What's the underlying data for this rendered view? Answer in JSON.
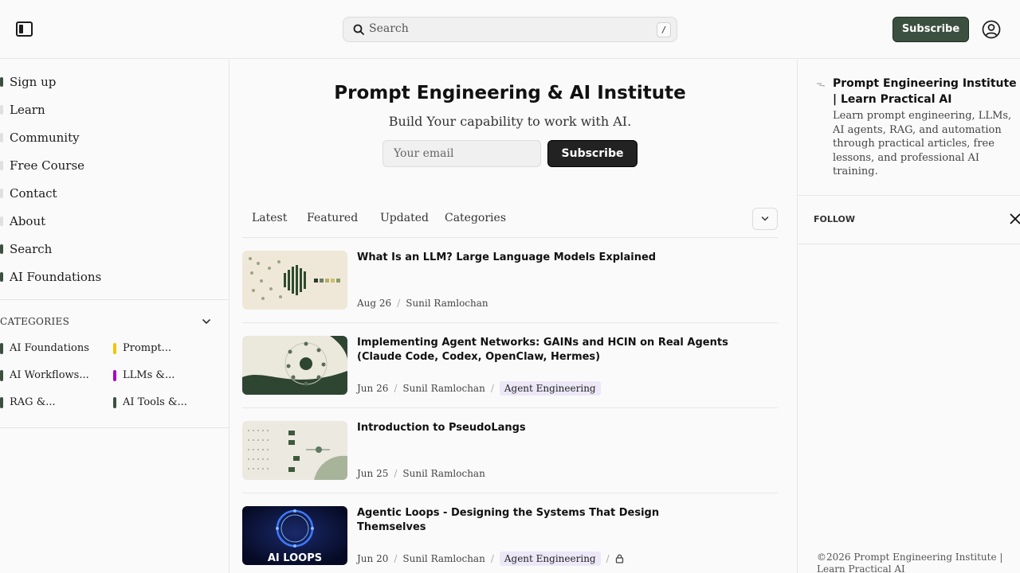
{
  "header": {
    "search_placeholder": "Search",
    "search_shortcut": "/",
    "subscribe_label": "Subscribe"
  },
  "sidebar": {
    "nav": [
      {
        "label": "Sign up",
        "dot": "dark"
      },
      {
        "label": "Learn",
        "dot": "light"
      },
      {
        "label": "Community",
        "dot": "light"
      },
      {
        "label": "Free Course",
        "dot": "light"
      },
      {
        "label": "Contact",
        "dot": "light"
      },
      {
        "label": "About",
        "dot": "light"
      },
      {
        "label": "Search",
        "dot": "dark"
      },
      {
        "label": "AI Foundations",
        "dot": "dark"
      }
    ],
    "categories_header": "CATEGORIES",
    "categories": [
      {
        "label": "AI Foundations",
        "color": "#3c5040"
      },
      {
        "label": "Prompt...",
        "color": "#f2c500"
      },
      {
        "label": "AI Workflows...",
        "color": "#3c5040"
      },
      {
        "label": "LLMs &...",
        "color": "#a800c8"
      },
      {
        "label": "RAG &...",
        "color": "#3c5040"
      },
      {
        "label": "AI Tools &...",
        "color": "#3c5040"
      }
    ]
  },
  "hero": {
    "title": "Prompt Engineering & AI Institute",
    "subtitle": "Build Your capability to work with AI.",
    "email_placeholder": "Your email",
    "subscribe_label": "Subscribe"
  },
  "tabs": [
    "Latest",
    "Featured",
    "Updated",
    "Categories"
  ],
  "posts": [
    {
      "title": "What Is an LLM? Large Language Models Explained",
      "date": "Aug 26",
      "author": "Sunil Ramlochan",
      "tag": "",
      "locked": false
    },
    {
      "title": "Implementing Agent Networks: GAINs and HCIN on Real Agents (Claude Code, Codex, OpenClaw, Hermes)",
      "date": "Jun 26",
      "author": "Sunil Ramlochan",
      "tag": "Agent Engineering",
      "locked": false
    },
    {
      "title": "Introduction to PseudoLangs",
      "date": "Jun 25",
      "author": "Sunil Ramlochan",
      "tag": "",
      "locked": false
    },
    {
      "title": "Agentic Loops - Designing the Systems That Design Themselves",
      "date": "Jun 20",
      "author": "Sunil Ramlochan",
      "tag": "Agent Engineering",
      "locked": true,
      "thumb_text": "AI LOOPS"
    }
  ],
  "right_panel": {
    "title": "Prompt Engineering Institute | Learn Practical AI",
    "description": "Learn prompt engineering, LLMs, AI agents, RAG, and automation through practical articles, free lessons, and professional AI training.",
    "follow_label": "FOLLOW",
    "footer": "©2026 Prompt Engineering Institute | Learn Practical AI"
  }
}
